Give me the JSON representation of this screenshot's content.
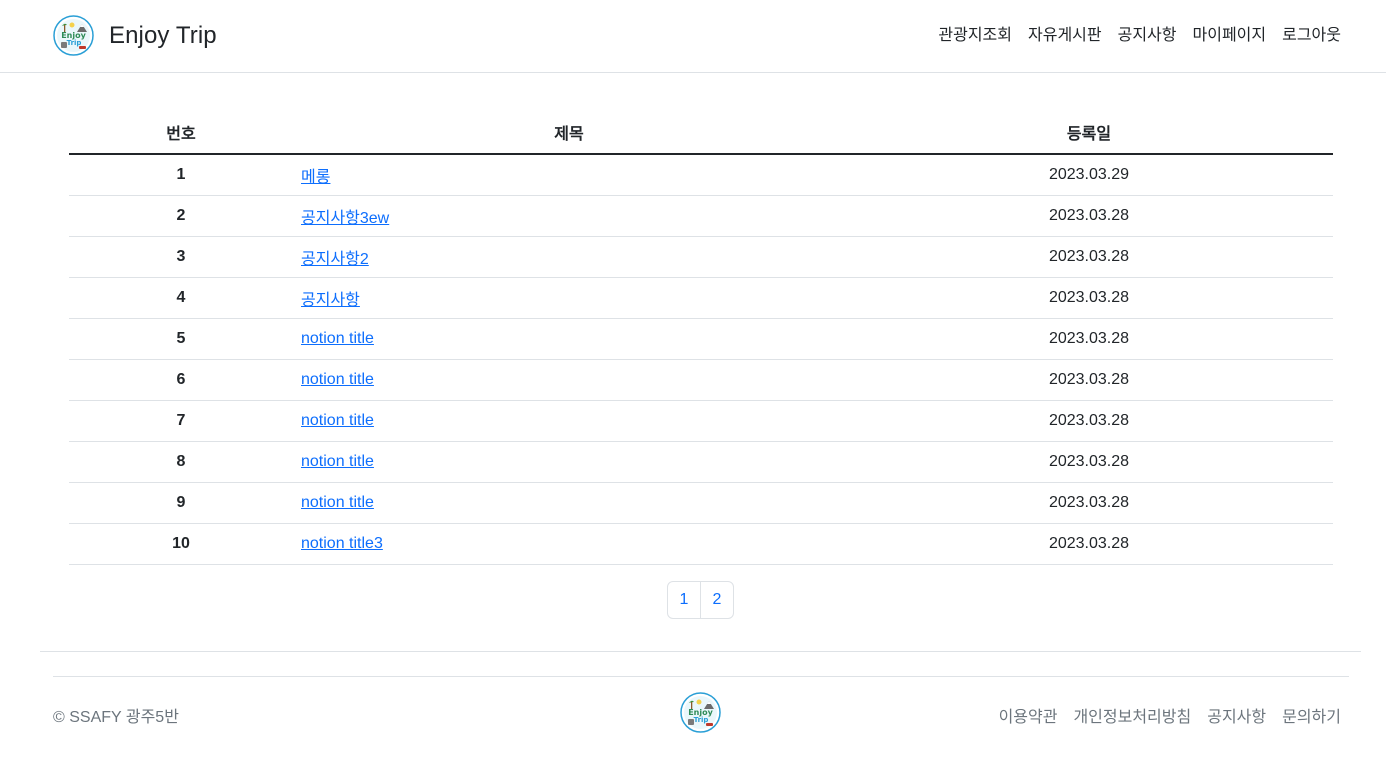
{
  "header": {
    "brand": "Enjoy Trip",
    "logo_icon": "enjoy-trip-logo-icon",
    "nav": [
      {
        "label": "관광지조회"
      },
      {
        "label": "자유게시판"
      },
      {
        "label": "공지사항"
      },
      {
        "label": "마이페이지"
      },
      {
        "label": "로그아웃"
      }
    ]
  },
  "table": {
    "columns": {
      "no": "번호",
      "title": "제목",
      "date": "등록일"
    },
    "rows": [
      {
        "no": "1",
        "title": "메롱",
        "date": "2023.03.29"
      },
      {
        "no": "2",
        "title": "공지사항3ew",
        "date": "2023.03.28"
      },
      {
        "no": "3",
        "title": "공지사항2",
        "date": "2023.03.28"
      },
      {
        "no": "4",
        "title": "공지사항",
        "date": "2023.03.28"
      },
      {
        "no": "5",
        "title": "notion title",
        "date": "2023.03.28"
      },
      {
        "no": "6",
        "title": "notion title",
        "date": "2023.03.28"
      },
      {
        "no": "7",
        "title": "notion title",
        "date": "2023.03.28"
      },
      {
        "no": "8",
        "title": "notion title",
        "date": "2023.03.28"
      },
      {
        "no": "9",
        "title": "notion title",
        "date": "2023.03.28"
      },
      {
        "no": "10",
        "title": "notion title3",
        "date": "2023.03.28"
      }
    ]
  },
  "pagination": {
    "pages": [
      "1",
      "2"
    ]
  },
  "footer": {
    "copyright": "© SSAFY 광주5반",
    "links": [
      {
        "label": "이용약관"
      },
      {
        "label": "개인정보처리방침"
      },
      {
        "label": "공지사항"
      },
      {
        "label": "문의하기"
      }
    ]
  },
  "colors": {
    "link": "#0d6efd",
    "border": "#dee2e6",
    "muted": "#6c757d"
  }
}
